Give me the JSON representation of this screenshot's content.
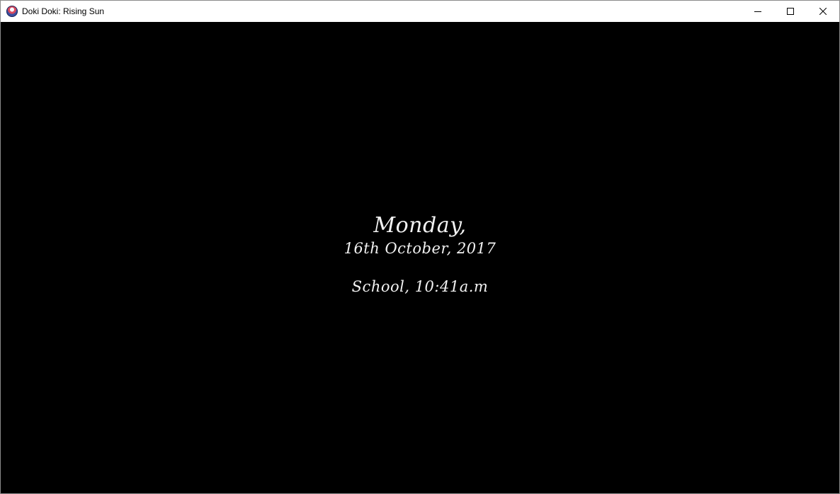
{
  "window": {
    "title": "Doki Doki: Rising Sun",
    "controls": {
      "minimize": "minimize-icon",
      "maximize": "maximize-icon",
      "close": "close-icon"
    }
  },
  "scene": {
    "day": "Monday,",
    "date": "16th October, 2017",
    "time_location": "School, 10:41a.m"
  },
  "colors": {
    "background": "#000000",
    "text": "#f2f2f2",
    "titlebar": "#ffffff"
  }
}
